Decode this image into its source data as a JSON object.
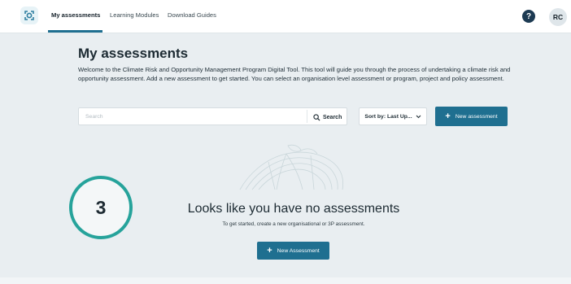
{
  "nav": {
    "tabs": [
      {
        "label": "My assessments",
        "active": true
      },
      {
        "label": "Learning Modules",
        "active": false
      },
      {
        "label": "Download Guides",
        "active": false
      }
    ],
    "help_label": "?",
    "avatar_initials": "RC"
  },
  "page": {
    "title": "My assessments",
    "description": "Welcome to the Climate Risk and Opportunity Management Program Digital Tool. This tool will guide you through the process of undertaking a climate risk and opportunity assessment. Add a new assessment to get started. You can select an organisation level assessment or program, project and policy assessment."
  },
  "toolbar": {
    "search_placeholder": "Search",
    "search_button": "Search",
    "sort_label": "Sort by: Last Up...",
    "new_assessment_label": "New assessment"
  },
  "empty_state": {
    "step_number": "3",
    "title": "Looks like you have no assessments",
    "subtitle": "To get started, create a new organisational or 3P assessment.",
    "button_label": "New Assessment"
  },
  "colors": {
    "accent": "#1f6f90",
    "step_ring": "#26a39b",
    "background": "#e9eef1"
  }
}
